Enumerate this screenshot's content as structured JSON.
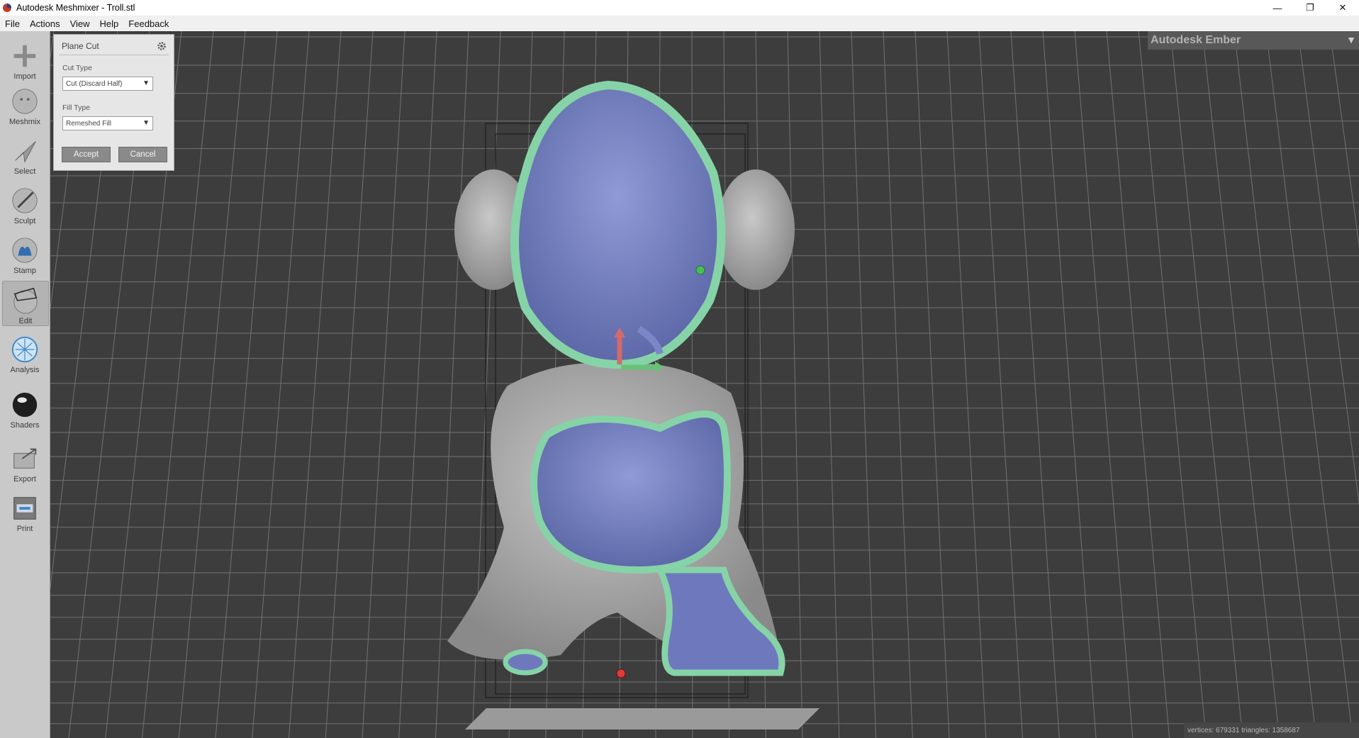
{
  "window": {
    "title": "Autodesk Meshmixer - Troll.stl",
    "controls": {
      "minimize": "—",
      "restore": "❐",
      "close": "✕"
    }
  },
  "menu": [
    "File",
    "Actions",
    "View",
    "Help",
    "Feedback"
  ],
  "toolbar": {
    "tools": [
      {
        "label": "Import",
        "icon": "import-icon"
      },
      {
        "label": "Meshmix",
        "icon": "meshmix-icon"
      },
      {
        "label": "Select",
        "icon": "select-icon"
      },
      {
        "label": "Sculpt",
        "icon": "sculpt-icon"
      },
      {
        "label": "Stamp",
        "icon": "stamp-icon"
      },
      {
        "label": "Edit",
        "icon": "edit-icon",
        "active": true
      },
      {
        "label": "Analysis",
        "icon": "analysis-icon"
      },
      {
        "label": "Shaders",
        "icon": "shaders-icon"
      },
      {
        "label": "Export",
        "icon": "export-icon"
      },
      {
        "label": "Print",
        "icon": "print-icon"
      }
    ]
  },
  "plane_cut": {
    "title": "Plane Cut",
    "cut_type_label": "Cut Type",
    "cut_type_value": "Cut (Discard Half)",
    "fill_type_label": "Fill Type",
    "fill_type_value": "Remeshed Fill",
    "accept_label": "Accept",
    "cancel_label": "Cancel"
  },
  "ember_panel": {
    "title": "Autodesk Ember",
    "collapse_icon": "▼"
  },
  "status": {
    "text": "vertices: 679331 triangles: 1358687"
  },
  "colors": {
    "viewport_bg": "#3d3d3d",
    "grid": "#6e6e6e",
    "model": "#a9a9a9",
    "cut_region": "#7b86c8",
    "cut_outline": "#86d3a8",
    "toolbar_bg": "#c9c9c9"
  }
}
